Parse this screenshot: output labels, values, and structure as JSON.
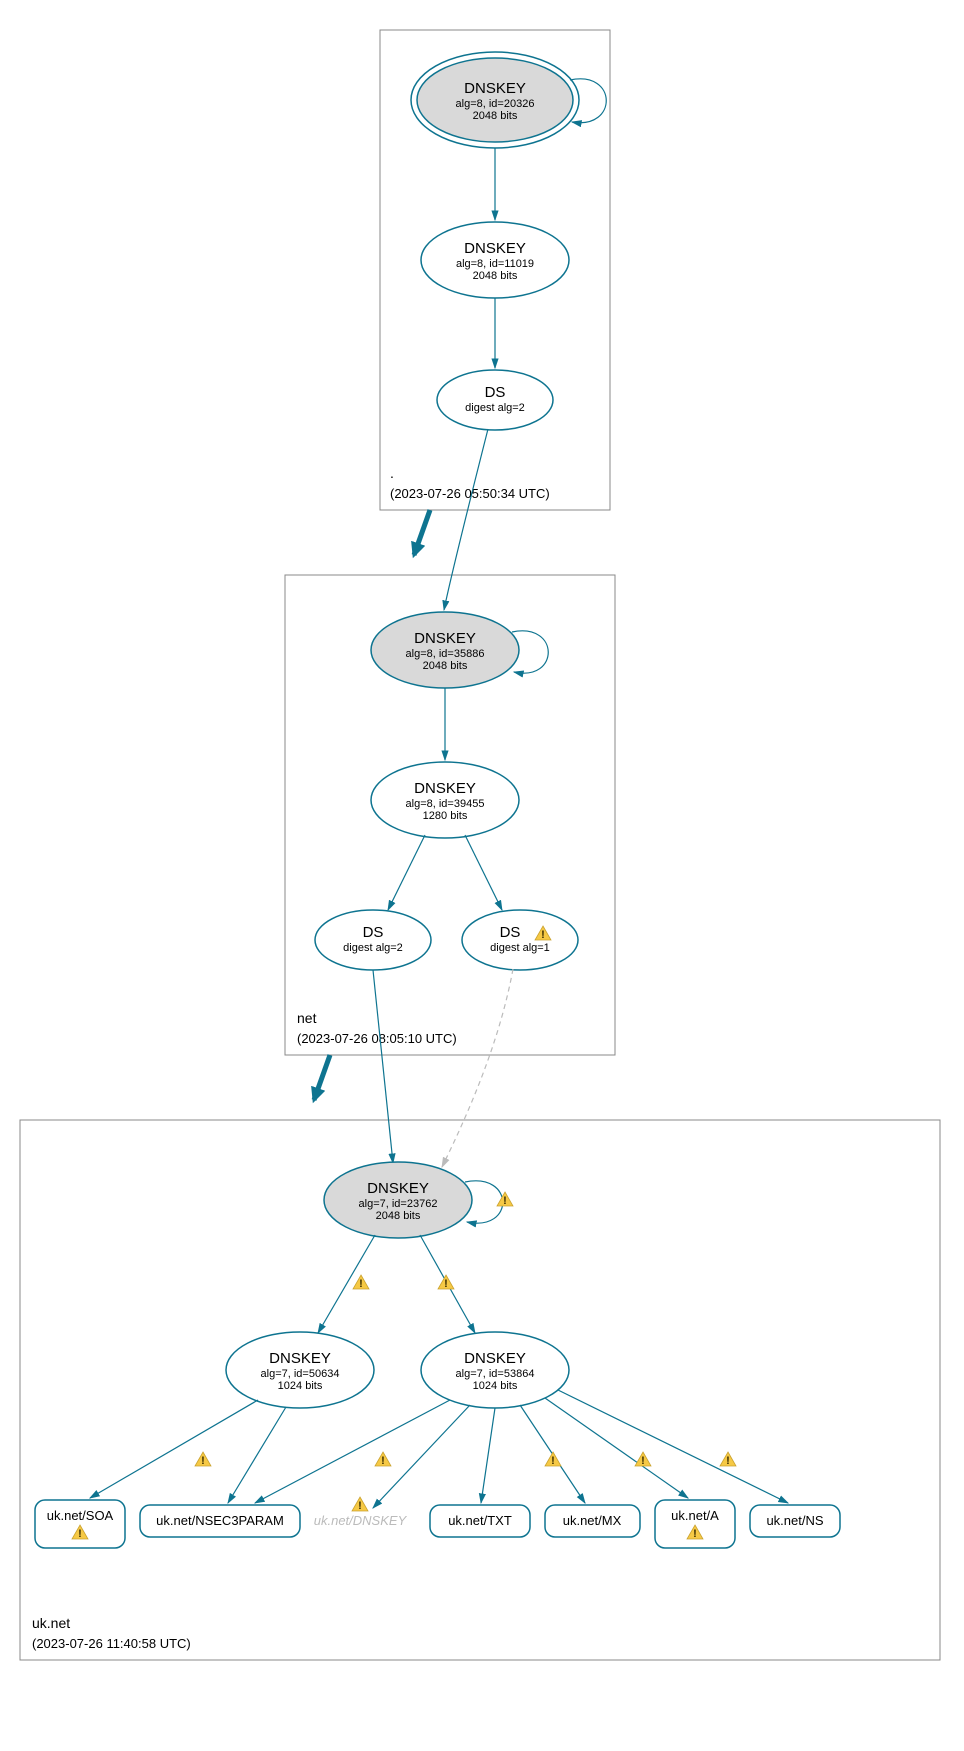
{
  "zones": {
    "root": {
      "label": ".",
      "timestamp": "(2023-07-26 05:50:34 UTC)"
    },
    "net": {
      "label": "net",
      "timestamp": "(2023-07-26 08:05:10 UTC)"
    },
    "uknet": {
      "label": "uk.net",
      "timestamp": "(2023-07-26 11:40:58 UTC)"
    }
  },
  "nodes": {
    "root_ksk": {
      "title": "DNSKEY",
      "line2": "alg=8, id=20326",
      "line3": "2048 bits"
    },
    "root_zsk": {
      "title": "DNSKEY",
      "line2": "alg=8, id=11019",
      "line3": "2048 bits"
    },
    "root_ds": {
      "title": "DS",
      "line2": "digest alg=2"
    },
    "net_ksk": {
      "title": "DNSKEY",
      "line2": "alg=8, id=35886",
      "line3": "2048 bits"
    },
    "net_zsk": {
      "title": "DNSKEY",
      "line2": "alg=8, id=39455",
      "line3": "1280 bits"
    },
    "net_ds2": {
      "title": "DS",
      "line2": "digest alg=2"
    },
    "net_ds1": {
      "title": "DS",
      "line2": "digest alg=1"
    },
    "uknet_ksk": {
      "title": "DNSKEY",
      "line2": "alg=7, id=23762",
      "line3": "2048 bits"
    },
    "uknet_zsk1": {
      "title": "DNSKEY",
      "line2": "alg=7, id=50634",
      "line3": "1024 bits"
    },
    "uknet_zsk2": {
      "title": "DNSKEY",
      "line2": "alg=7, id=53864",
      "line3": "1024 bits"
    }
  },
  "rrsets": {
    "soa": "uk.net/SOA",
    "nsec3param": "uk.net/NSEC3PARAM",
    "dnskey": "uk.net/DNSKEY",
    "txt": "uk.net/TXT",
    "mx": "uk.net/MX",
    "a": "uk.net/A",
    "ns": "uk.net/NS"
  }
}
